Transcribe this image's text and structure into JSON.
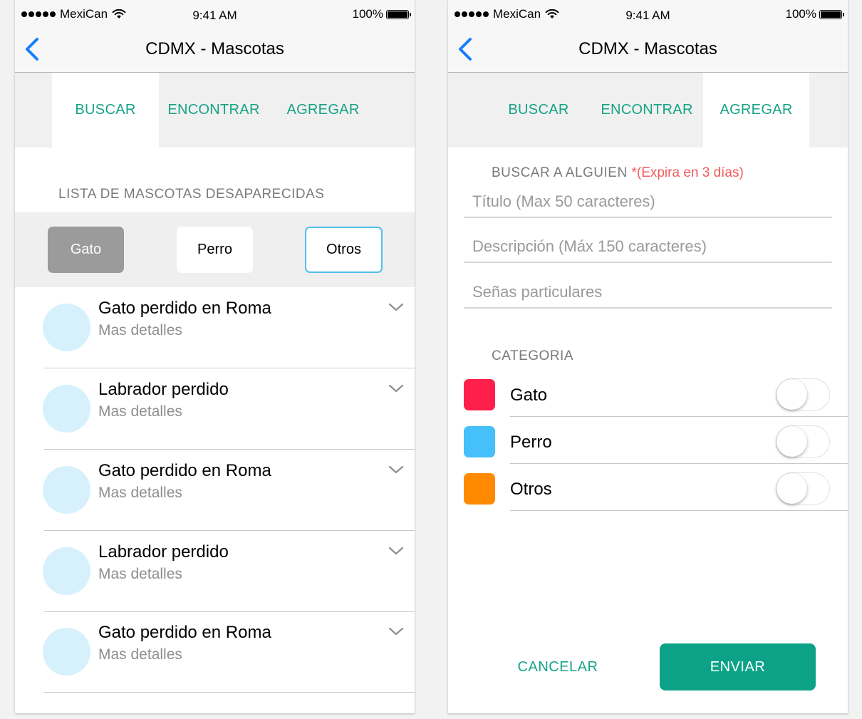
{
  "status_bar": {
    "carrier": "MexiCan",
    "time": "9:41 AM",
    "battery": "100%"
  },
  "nav": {
    "title": "CDMX - Mascotas"
  },
  "tabs": [
    {
      "label": "BUSCAR"
    },
    {
      "label": "ENCONTRAR"
    },
    {
      "label": "AGREGAR"
    }
  ],
  "colors": {
    "accent": "#17a388",
    "ios_blue": "#157efb",
    "cat_gato": "#ff1f4b",
    "cat_perro": "#45c0fb",
    "cat_otros": "#ff8a00"
  },
  "left_screen": {
    "active_tab": "BUSCAR",
    "section_title": "LISTA DE MASCOTAS DESAPARECIDAS",
    "filters": [
      {
        "label": "Gato",
        "state": "selected"
      },
      {
        "label": "Perro",
        "state": "normal"
      },
      {
        "label": "Otros",
        "state": "highlighted"
      }
    ],
    "items": [
      {
        "title": "Gato perdido en Roma",
        "subtitle": "Mas detalles"
      },
      {
        "title": "Labrador perdido",
        "subtitle": "Mas detalles"
      },
      {
        "title": "Gato perdido en Roma",
        "subtitle": "Mas detalles"
      },
      {
        "title": "Labrador perdido",
        "subtitle": "Mas detalles"
      },
      {
        "title": "Gato perdido en Roma",
        "subtitle": "Mas detalles"
      }
    ]
  },
  "right_screen": {
    "active_tab": "AGREGAR",
    "form_title": "BUSCAR A ALGUIEN",
    "form_note": "*(Expira en 3 días)",
    "fields": {
      "title_placeholder": "Título (Max 50 caracteres)",
      "description_placeholder": "Descripción (Máx 150 caracteres)",
      "marks_placeholder": "Señas particulares"
    },
    "category_title": "CATEGORIA",
    "categories": [
      {
        "label": "Gato",
        "on": false
      },
      {
        "label": "Perro",
        "on": false
      },
      {
        "label": "Otros",
        "on": false
      }
    ],
    "cancel_label": "CANCELAR",
    "send_label": "ENVIAR"
  }
}
